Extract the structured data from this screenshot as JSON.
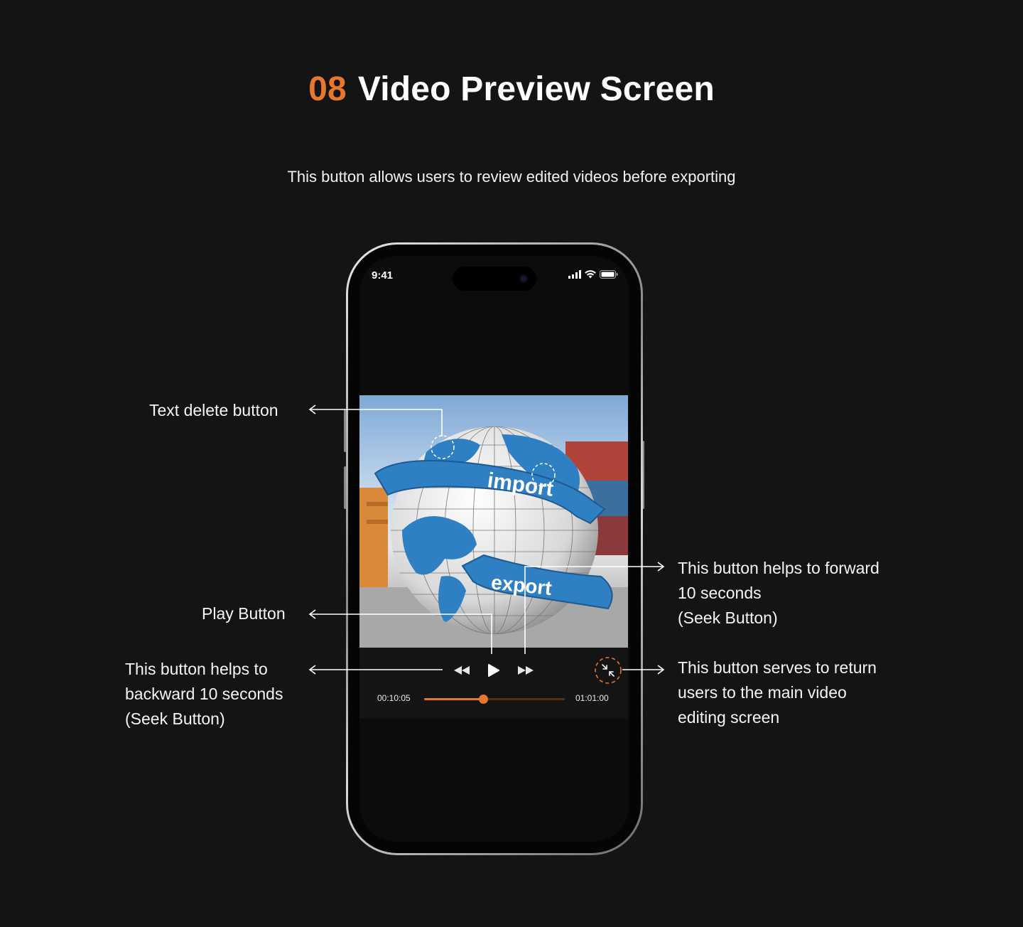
{
  "header": {
    "number": "08",
    "title": "Video Preview Screen",
    "subtitle": "This button allows users to review edited videos before exporting"
  },
  "annotations": {
    "text_delete": "Text delete button",
    "play": "Play Button",
    "backward": [
      "This button helps to",
      "backward 10 seconds",
      "(Seek Button)"
    ],
    "forward": [
      "This button helps to forward",
      "10 seconds",
      "(Seek Button)"
    ],
    "return": [
      "This button serves to return",
      "users to the main video",
      "editing screen"
    ]
  },
  "phone": {
    "status_time": "9:41",
    "video_words": {
      "top": "import",
      "bottom": "export"
    },
    "player": {
      "current_time": "00:10:05",
      "total_time": "01:01:00",
      "progress": 0.42
    }
  },
  "colors": {
    "accent": "#E8772E",
    "background": "#141414",
    "globe_blue": "#2f7fc3"
  },
  "icons": [
    "rewind-icon",
    "play-icon",
    "fast-forward-icon",
    "minimize-icon",
    "signal-icon",
    "wifi-icon",
    "battery-icon"
  ]
}
